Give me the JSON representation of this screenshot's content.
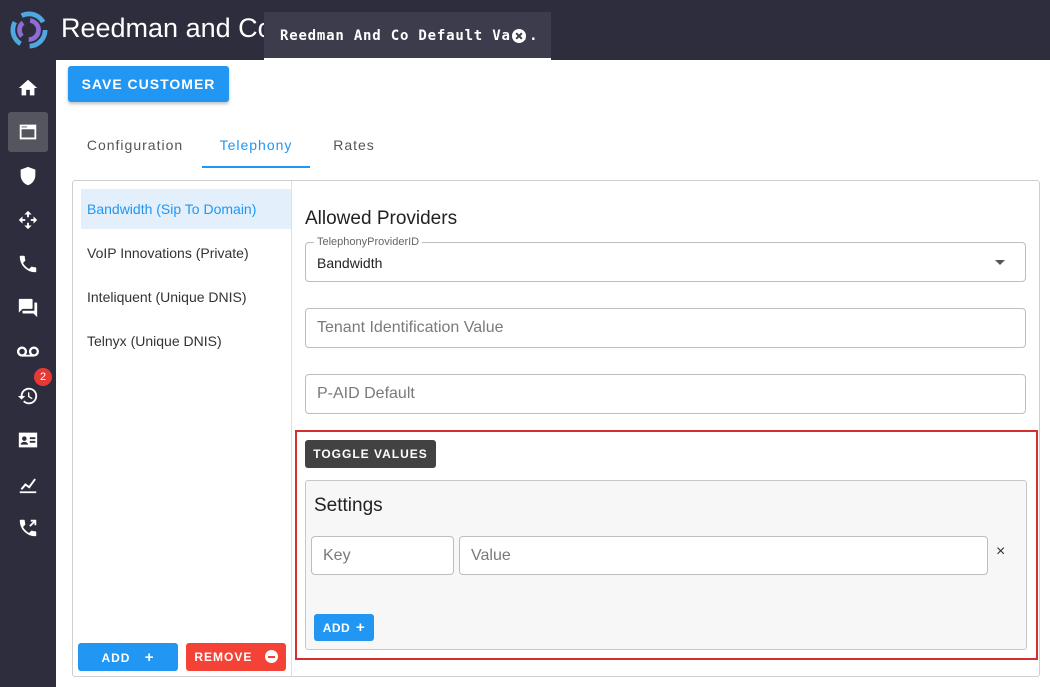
{
  "app": {
    "brand": "Reedman and Co"
  },
  "document_tab": {
    "label": "Reedman And Co Default Va...",
    "close_icon": "close-circle-icon"
  },
  "sidebar": {
    "items": [
      {
        "name": "home",
        "icon": "home-icon"
      },
      {
        "name": "windows",
        "icon": "window-icon",
        "active": true
      },
      {
        "name": "security",
        "icon": "shield-icon"
      },
      {
        "name": "routing",
        "icon": "diamond-arrows-icon"
      },
      {
        "name": "phone",
        "icon": "phone-icon"
      },
      {
        "name": "messages",
        "icon": "chat-icon"
      },
      {
        "name": "voicemail",
        "icon": "voicemail-icon"
      },
      {
        "name": "history",
        "icon": "history-icon",
        "badge": "2"
      },
      {
        "name": "contacts",
        "icon": "contact-card-icon"
      },
      {
        "name": "analytics",
        "icon": "chart-icon"
      },
      {
        "name": "forwarding",
        "icon": "phone-forward-icon"
      }
    ]
  },
  "toolbar": {
    "save_label": "SAVE CUSTOMER"
  },
  "tabs": [
    {
      "label": "Configuration"
    },
    {
      "label": "Telephony",
      "active": true
    },
    {
      "label": "Rates"
    }
  ],
  "providers": {
    "items": [
      {
        "label": "Bandwidth (Sip To Domain)",
        "selected": true
      },
      {
        "label": "VoIP Innovations (Private)"
      },
      {
        "label": "Inteliquent (Unique DNIS)"
      },
      {
        "label": "Telnyx (Unique DNIS)"
      }
    ],
    "add_label": "ADD",
    "remove_label": "REMOVE"
  },
  "detail": {
    "title": "Allowed Providers",
    "provider_select": {
      "legend": "TelephonyProviderID",
      "value": "Bandwidth"
    },
    "tenant_field": {
      "placeholder": "Tenant Identification Value"
    },
    "paid_field": {
      "placeholder": "P-AID Default"
    },
    "toggle_label": "TOGGLE VALUES",
    "settings": {
      "title": "Settings",
      "key_placeholder": "Key",
      "value_placeholder": "Value",
      "delete_symbol": "×",
      "add_label": "ADD"
    }
  },
  "colors": {
    "accent": "#2196f3",
    "danger": "#f44336",
    "highlight_border": "#d32f2f",
    "sidebar_bg": "#2d2d3d"
  }
}
